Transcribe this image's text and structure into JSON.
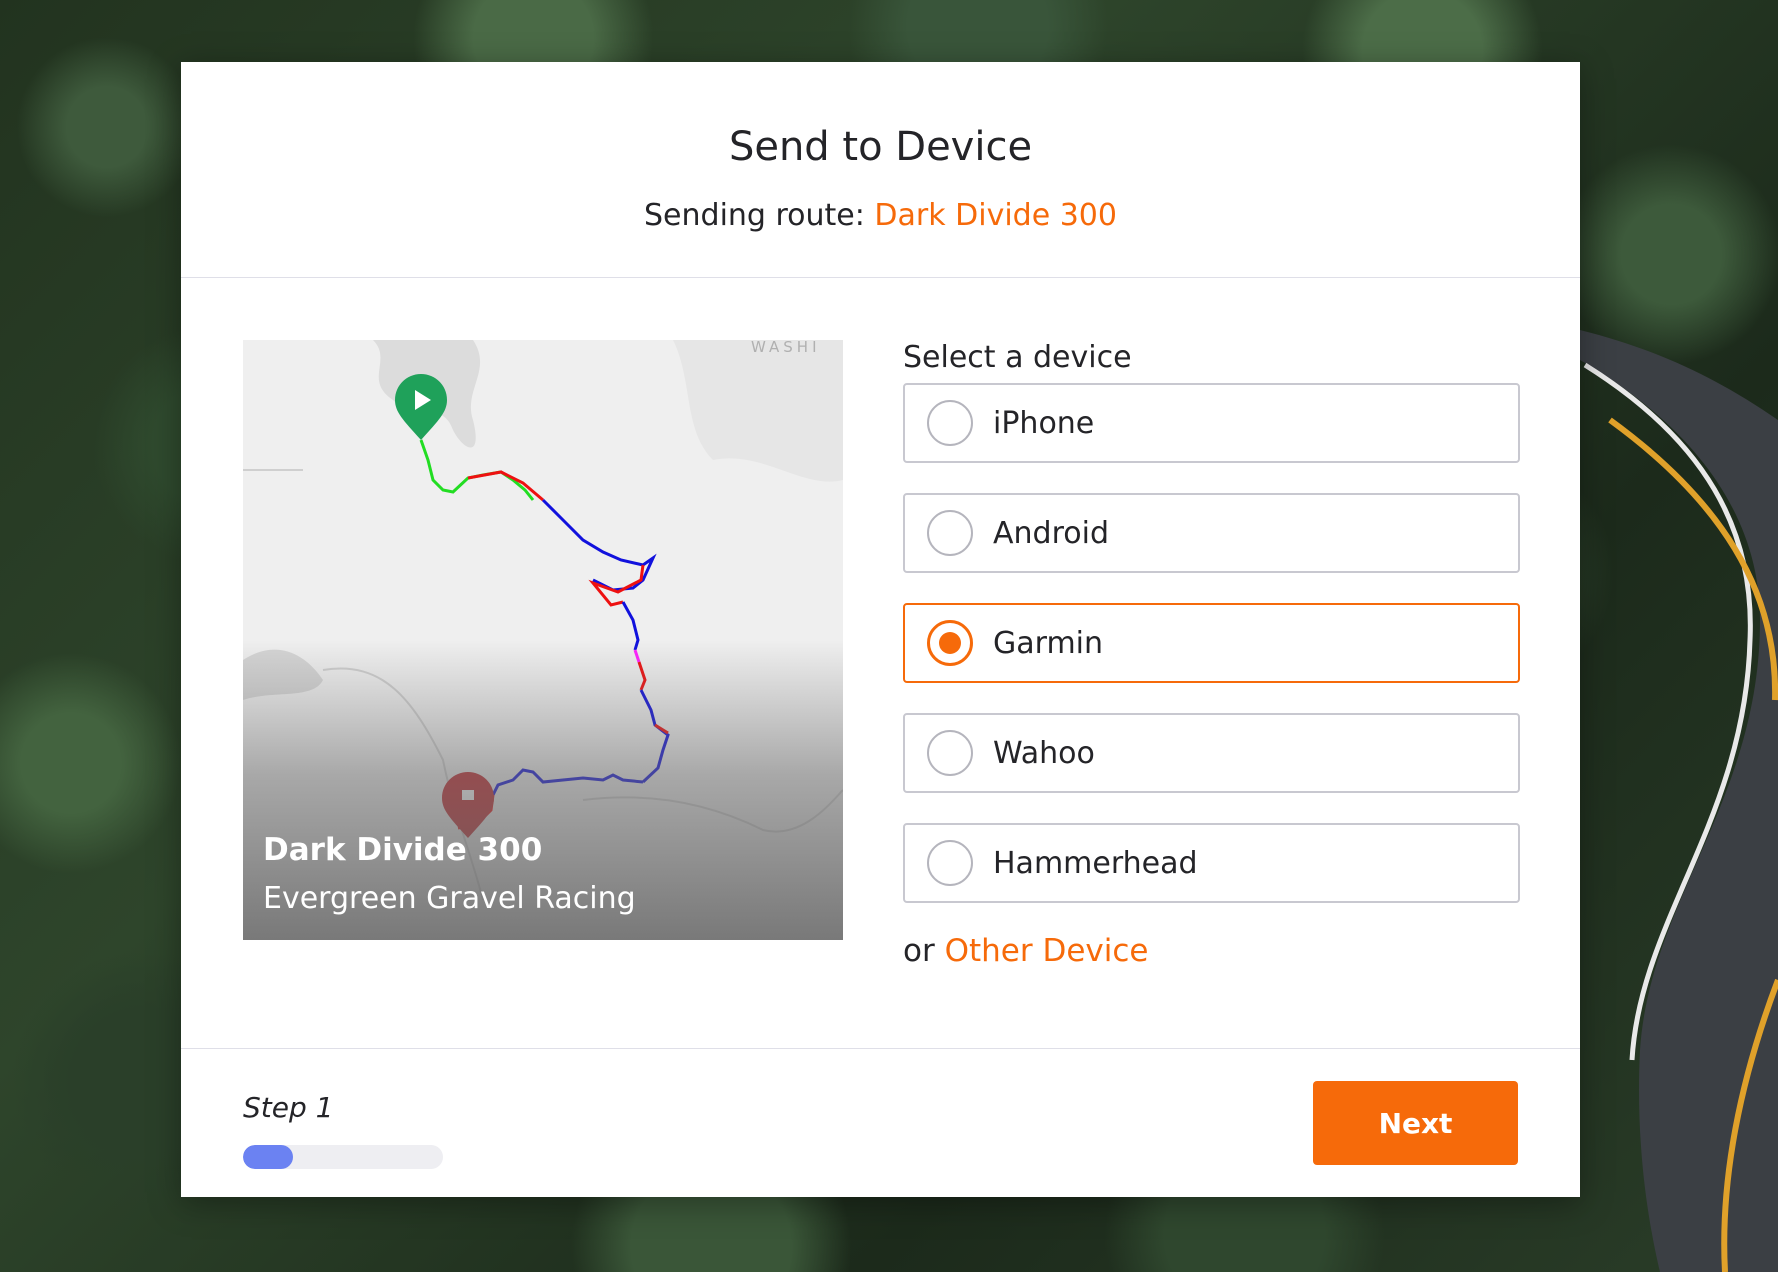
{
  "modal": {
    "title": "Send to Device",
    "route_prefix": "Sending route: ",
    "route_name": "Dark Divide 300"
  },
  "map": {
    "label": "WASHI",
    "route_title": "Dark Divide 300",
    "route_club": "Evergreen Gravel Racing"
  },
  "devices": {
    "heading": "Select a device",
    "options": [
      {
        "label": "iPhone",
        "selected": false
      },
      {
        "label": "Android",
        "selected": false
      },
      {
        "label": "Garmin",
        "selected": true
      },
      {
        "label": "Wahoo",
        "selected": false
      },
      {
        "label": "Hammerhead",
        "selected": false
      }
    ],
    "other_prefix": "or ",
    "other_link": "Other Device"
  },
  "footer": {
    "step_label": "Step 1",
    "progress": 0.25,
    "next_label": "Next"
  },
  "colors": {
    "accent": "#f66a0a",
    "progress": "#6b82f2"
  }
}
